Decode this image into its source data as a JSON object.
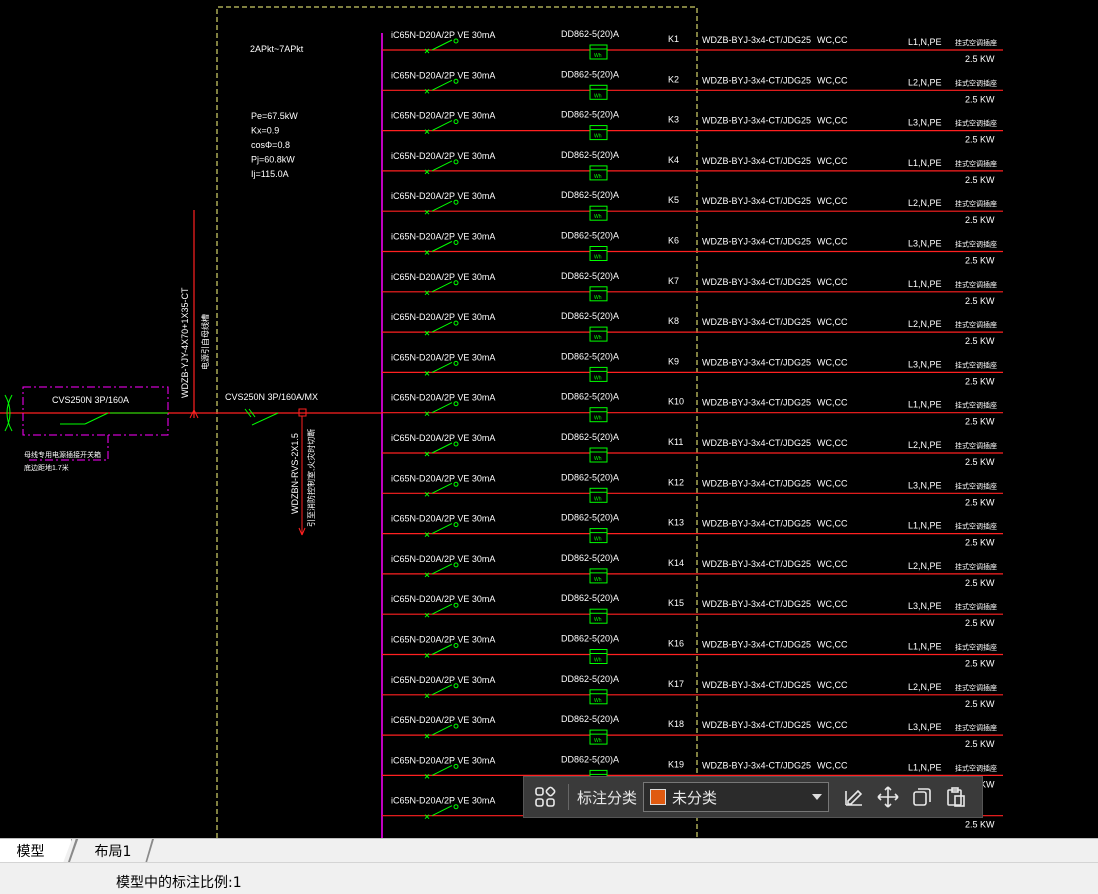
{
  "drawing": {
    "header_cabinet": "2APkt~7APkt",
    "params": [
      "Pe=67.5kW",
      "Kx=0.9",
      "cosΦ=0.8",
      "Pj=60.8kW",
      "Ij=115.0A"
    ],
    "incoming_cable": "WDZB-YJY-4X70+1X35-CT",
    "incoming_note": "电源引自母线槽",
    "tap_box_breaker": "CVS250N 3P/160A",
    "tap_box_note1": "母线专用电源插接开关箱",
    "tap_box_note2": "底边距地1.7米",
    "main_breaker": "CVS250N 3P/160A/MX",
    "fire_cable": "WDZBN-RVS-2X1.5",
    "fire_note": "引至消防控制室,火灾时切断",
    "circuits": [
      {
        "breaker": "iC65N-D20A/2P VE 30mA",
        "meter": "DD862-5(20)A",
        "meter_unit": "Wh",
        "id": "K1",
        "cable": "WDZB-BYJ-3x4-CT/JDG25",
        "laying": "WC,CC",
        "phase": "L1,N,PE",
        "load_desc": "挂式空调插座",
        "power": "2.5 KW"
      },
      {
        "breaker": "iC65N-D20A/2P VE 30mA",
        "meter": "DD862-5(20)A",
        "meter_unit": "Wh",
        "id": "K2",
        "cable": "WDZB-BYJ-3x4-CT/JDG25",
        "laying": "WC,CC",
        "phase": "L2,N,PE",
        "load_desc": "挂式空调插座",
        "power": "2.5 KW"
      },
      {
        "breaker": "iC65N-D20A/2P VE 30mA",
        "meter": "DD862-5(20)A",
        "meter_unit": "Wh",
        "id": "K3",
        "cable": "WDZB-BYJ-3x4-CT/JDG25",
        "laying": "WC,CC",
        "phase": "L3,N,PE",
        "load_desc": "挂式空调插座",
        "power": "2.5 KW"
      },
      {
        "breaker": "iC65N-D20A/2P VE 30mA",
        "meter": "DD862-5(20)A",
        "meter_unit": "Wh",
        "id": "K4",
        "cable": "WDZB-BYJ-3x4-CT/JDG25",
        "laying": "WC,CC",
        "phase": "L1,N,PE",
        "load_desc": "挂式空调插座",
        "power": "2.5 KW"
      },
      {
        "breaker": "iC65N-D20A/2P VE 30mA",
        "meter": "DD862-5(20)A",
        "meter_unit": "Wh",
        "id": "K5",
        "cable": "WDZB-BYJ-3x4-CT/JDG25",
        "laying": "WC,CC",
        "phase": "L2,N,PE",
        "load_desc": "挂式空调插座",
        "power": "2.5 KW"
      },
      {
        "breaker": "iC65N-D20A/2P VE 30mA",
        "meter": "DD862-5(20)A",
        "meter_unit": "Wh",
        "id": "K6",
        "cable": "WDZB-BYJ-3x4-CT/JDG25",
        "laying": "WC,CC",
        "phase": "L3,N,PE",
        "load_desc": "挂式空调插座",
        "power": "2.5 KW"
      },
      {
        "breaker": "iC65N-D20A/2P VE 30mA",
        "meter": "DD862-5(20)A",
        "meter_unit": "Wh",
        "id": "K7",
        "cable": "WDZB-BYJ-3x4-CT/JDG25",
        "laying": "WC,CC",
        "phase": "L1,N,PE",
        "load_desc": "挂式空调插座",
        "power": "2.5 KW"
      },
      {
        "breaker": "iC65N-D20A/2P VE 30mA",
        "meter": "DD862-5(20)A",
        "meter_unit": "Wh",
        "id": "K8",
        "cable": "WDZB-BYJ-3x4-CT/JDG25",
        "laying": "WC,CC",
        "phase": "L2,N,PE",
        "load_desc": "挂式空调插座",
        "power": "2.5 KW"
      },
      {
        "breaker": "iC65N-D20A/2P VE 30mA",
        "meter": "DD862-5(20)A",
        "meter_unit": "Wh",
        "id": "K9",
        "cable": "WDZB-BYJ-3x4-CT/JDG25",
        "laying": "WC,CC",
        "phase": "L3,N,PE",
        "load_desc": "挂式空调插座",
        "power": "2.5 KW"
      },
      {
        "breaker": "iC65N-D20A/2P VE 30mA",
        "meter": "DD862-5(20)A",
        "meter_unit": "Wh",
        "id": "K10",
        "cable": "WDZB-BYJ-3x4-CT/JDG25",
        "laying": "WC,CC",
        "phase": "L1,N,PE",
        "load_desc": "挂式空调插座",
        "power": "2.5 KW"
      },
      {
        "breaker": "iC65N-D20A/2P VE 30mA",
        "meter": "DD862-5(20)A",
        "meter_unit": "Wh",
        "id": "K11",
        "cable": "WDZB-BYJ-3x4-CT/JDG25",
        "laying": "WC,CC",
        "phase": "L2,N,PE",
        "load_desc": "挂式空调插座",
        "power": "2.5 KW"
      },
      {
        "breaker": "iC65N-D20A/2P VE 30mA",
        "meter": "DD862-5(20)A",
        "meter_unit": "Wh",
        "id": "K12",
        "cable": "WDZB-BYJ-3x4-CT/JDG25",
        "laying": "WC,CC",
        "phase": "L3,N,PE",
        "load_desc": "挂式空调插座",
        "power": "2.5 KW"
      },
      {
        "breaker": "iC65N-D20A/2P VE 30mA",
        "meter": "DD862-5(20)A",
        "meter_unit": "Wh",
        "id": "K13",
        "cable": "WDZB-BYJ-3x4-CT/JDG25",
        "laying": "WC,CC",
        "phase": "L1,N,PE",
        "load_desc": "挂式空调插座",
        "power": "2.5 KW"
      },
      {
        "breaker": "iC65N-D20A/2P VE 30mA",
        "meter": "DD862-5(20)A",
        "meter_unit": "Wh",
        "id": "K14",
        "cable": "WDZB-BYJ-3x4-CT/JDG25",
        "laying": "WC,CC",
        "phase": "L2,N,PE",
        "load_desc": "挂式空调插座",
        "power": "2.5 KW"
      },
      {
        "breaker": "iC65N-D20A/2P VE 30mA",
        "meter": "DD862-5(20)A",
        "meter_unit": "Wh",
        "id": "K15",
        "cable": "WDZB-BYJ-3x4-CT/JDG25",
        "laying": "WC,CC",
        "phase": "L3,N,PE",
        "load_desc": "挂式空调插座",
        "power": "2.5 KW"
      },
      {
        "breaker": "iC65N-D20A/2P VE 30mA",
        "meter": "DD862-5(20)A",
        "meter_unit": "Wh",
        "id": "K16",
        "cable": "WDZB-BYJ-3x4-CT/JDG25",
        "laying": "WC,CC",
        "phase": "L1,N,PE",
        "load_desc": "挂式空调插座",
        "power": "2.5 KW"
      },
      {
        "breaker": "iC65N-D20A/2P VE 30mA",
        "meter": "DD862-5(20)A",
        "meter_unit": "Wh",
        "id": "K17",
        "cable": "WDZB-BYJ-3x4-CT/JDG25",
        "laying": "WC,CC",
        "phase": "L2,N,PE",
        "load_desc": "挂式空调插座",
        "power": "2.5 KW"
      },
      {
        "breaker": "iC65N-D20A/2P VE 30mA",
        "meter": "DD862-5(20)A",
        "meter_unit": "Wh",
        "id": "K18",
        "cable": "WDZB-BYJ-3x4-CT/JDG25",
        "laying": "WC,CC",
        "phase": "L3,N,PE",
        "load_desc": "挂式空调插座",
        "power": "2.5 KW"
      },
      {
        "breaker": "iC65N-D20A/2P VE 30mA",
        "meter": "DD862-5(20)A",
        "meter_unit": "Wh",
        "id": "K19",
        "cable": "WDZB-BYJ-3x4-CT/JDG25",
        "laying": "WC,CC",
        "phase": "L1,N,PE",
        "load_desc": "挂式空调插座",
        "power": "2.5 KW"
      },
      {
        "breaker": "iC65N-D20A/2P VE 30mA",
        "meter": "",
        "meter_unit": "",
        "id": "",
        "cable": "",
        "laying": "",
        "phase": "",
        "load_desc": "",
        "power": "2.5 KW"
      }
    ],
    "colors": {
      "wire": "#ff2020",
      "bus": "#ff00ff",
      "text": "#ffffff",
      "symbol": "#00ff00",
      "border": "#ffff80"
    }
  },
  "toolbar": {
    "label": "标注分类",
    "select_value": "未分类",
    "swatch_color": "#e05a10",
    "icons": [
      "grid-icon",
      "edit-icon",
      "move-icon",
      "copy-icon",
      "paste-icon"
    ]
  },
  "tabs": [
    {
      "label": "模型",
      "active": true
    },
    {
      "label": "布局1",
      "active": false
    }
  ],
  "statusbar": {
    "text": "模型中的标注比例:1"
  }
}
